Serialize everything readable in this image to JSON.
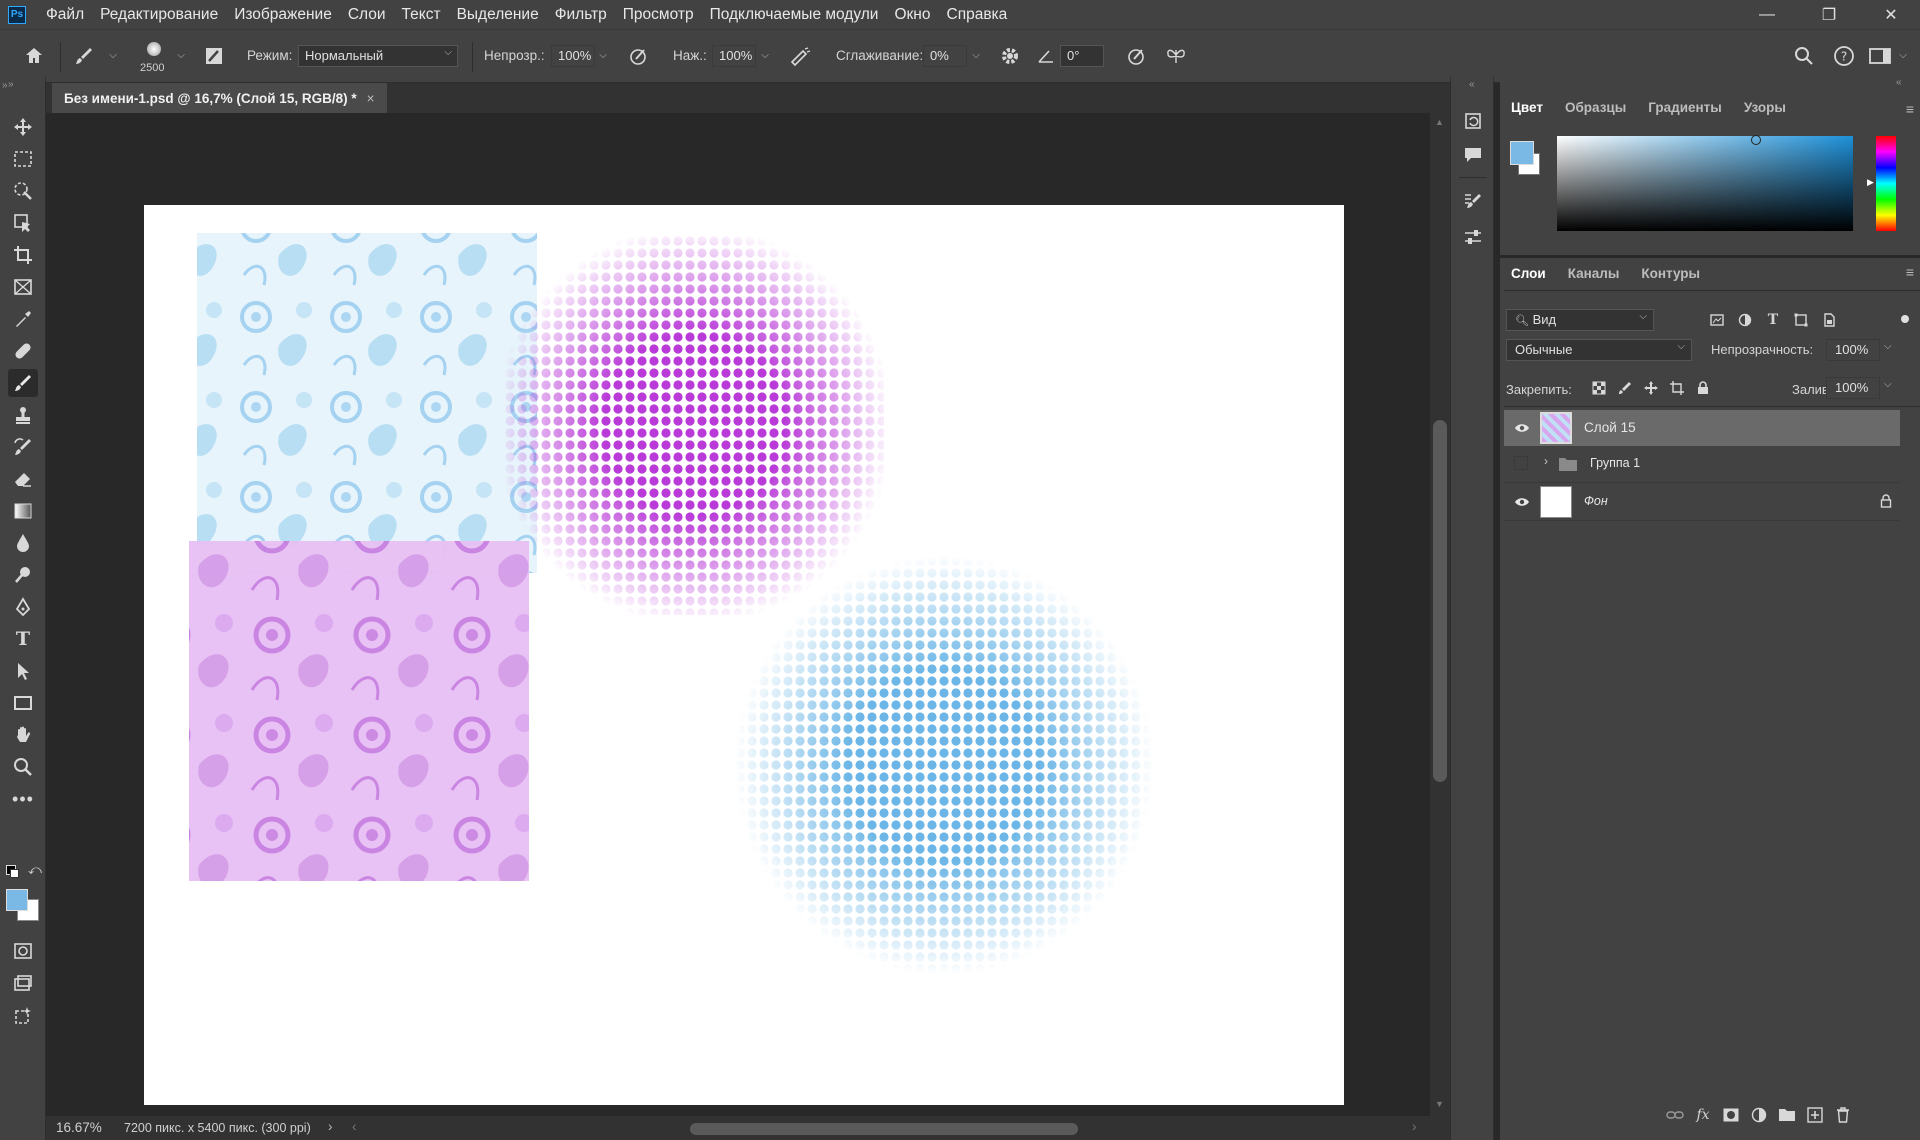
{
  "app": {
    "logo": "Ps"
  },
  "menu": [
    "Файл",
    "Редактирование",
    "Изображение",
    "Слои",
    "Текст",
    "Выделение",
    "Фильтр",
    "Просмотр",
    "Подключаемые модули",
    "Окно",
    "Справка"
  ],
  "window_controls": {
    "minimize": "—",
    "restore": "❐",
    "close": "✕"
  },
  "options": {
    "brush_size": "2500",
    "mode_label": "Режим:",
    "mode_value": "Нормальный",
    "opacity_label": "Непрозр.:",
    "opacity_value": "100%",
    "flow_label": "Наж.:",
    "flow_value": "100%",
    "smoothing_label": "Сглаживание:",
    "smoothing_value": "0%",
    "angle_value": "0°"
  },
  "document": {
    "tab_title": "Без имени-1.psd @ 16,7% (Слой 15, RGB/8) *",
    "close": "×",
    "colors": {
      "blue_pattern": "#bfe0f5",
      "purple_pattern": "#d9a6ee",
      "magenta_dots": "#b93ad8",
      "blue_dots": "#6bb6e6"
    }
  },
  "status": {
    "zoom": "16.67%",
    "info": "7200 пикс. x 5400 пикс. (300 ppi)",
    "arrow": "›"
  },
  "color_panel": {
    "tabs": [
      "Цвет",
      "Образцы",
      "Градиенты",
      "Узоры"
    ],
    "foreground": "#7ab8e6",
    "background": "#ffffff"
  },
  "layers_panel": {
    "tabs": [
      "Слои",
      "Каналы",
      "Контуры"
    ],
    "filter_label": "Вид",
    "blend_mode": "Обычные",
    "opacity_label": "Непрозрачность:",
    "opacity_value": "100%",
    "lock_label": "Закрепить:",
    "fill_label": "Заливка:",
    "fill_value": "100%",
    "layers": [
      {
        "name": "Слой 15",
        "visible": true,
        "selected": true
      },
      {
        "name": "Группа 1",
        "visible": false,
        "group": true
      },
      {
        "name": "Фон",
        "visible": true,
        "locked": true
      }
    ],
    "footer_icons": [
      "link-icon",
      "fx-icon",
      "mask-icon",
      "adjustment-icon",
      "folder-icon",
      "new-layer-icon",
      "trash-icon"
    ]
  }
}
